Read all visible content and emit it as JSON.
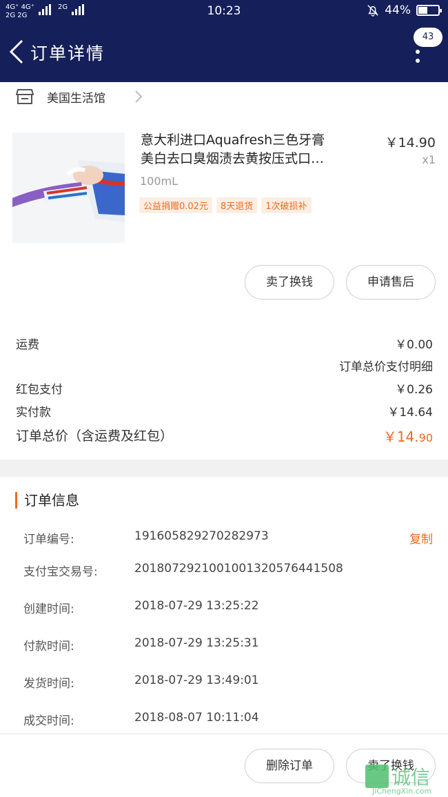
{
  "status_bar": {
    "network_left_top": "4G⁺ 4G⁺",
    "network_left_bottom": "2G 2G",
    "network_small": "2G",
    "time": "10:23",
    "battery": "44%",
    "battery_level": 0.44
  },
  "header": {
    "title": "订单详情",
    "badge": "43"
  },
  "store": {
    "name": "美国生活馆"
  },
  "product": {
    "title_line1": "意大利进口Aquafresh三色牙膏",
    "title_line2": "美白去口臭烟渍去黄按压式口…",
    "price": "￥14.90",
    "quantity": "x1",
    "spec": "100mL",
    "tags": [
      "公益捐赠0.02元",
      "8天退货",
      "1次破损补"
    ]
  },
  "actions": {
    "sell": "卖了换钱",
    "after_sale": "申请售后"
  },
  "fees": {
    "shipping_label": "运费",
    "shipping_value": "￥0.00",
    "detail_link": "订单总价支付明细",
    "redpacket_label": "红包支付",
    "redpacket_value": "￥0.26",
    "paid_label": "实付款",
    "paid_value": "￥14.64",
    "total_label": "订单总价（含运费及红包）",
    "total_major": "￥14.",
    "total_minor": "90"
  },
  "order_info": {
    "title": "订单信息",
    "order_no_label": "订单编号:",
    "order_no": "191605829270282973",
    "copy": "复制",
    "alipay_label": "支付宝交易号:",
    "alipay_no": "2018072921001001320576441508",
    "created_label": "创建时间:",
    "created": "2018-07-29 13:25:22",
    "paid_label": "付款时间:",
    "paid": "2018-07-29 13:25:31",
    "shipped_label": "发货时间:",
    "shipped": "2018-07-29 13:49:01",
    "closed_label": "成交时间:",
    "closed": "2018-08-07 10:11:04"
  },
  "bottom": {
    "delete": "删除订单",
    "sell": "卖了换钱"
  },
  "watermark": {
    "text": "诚信",
    "url": "JiChengXin.com"
  }
}
